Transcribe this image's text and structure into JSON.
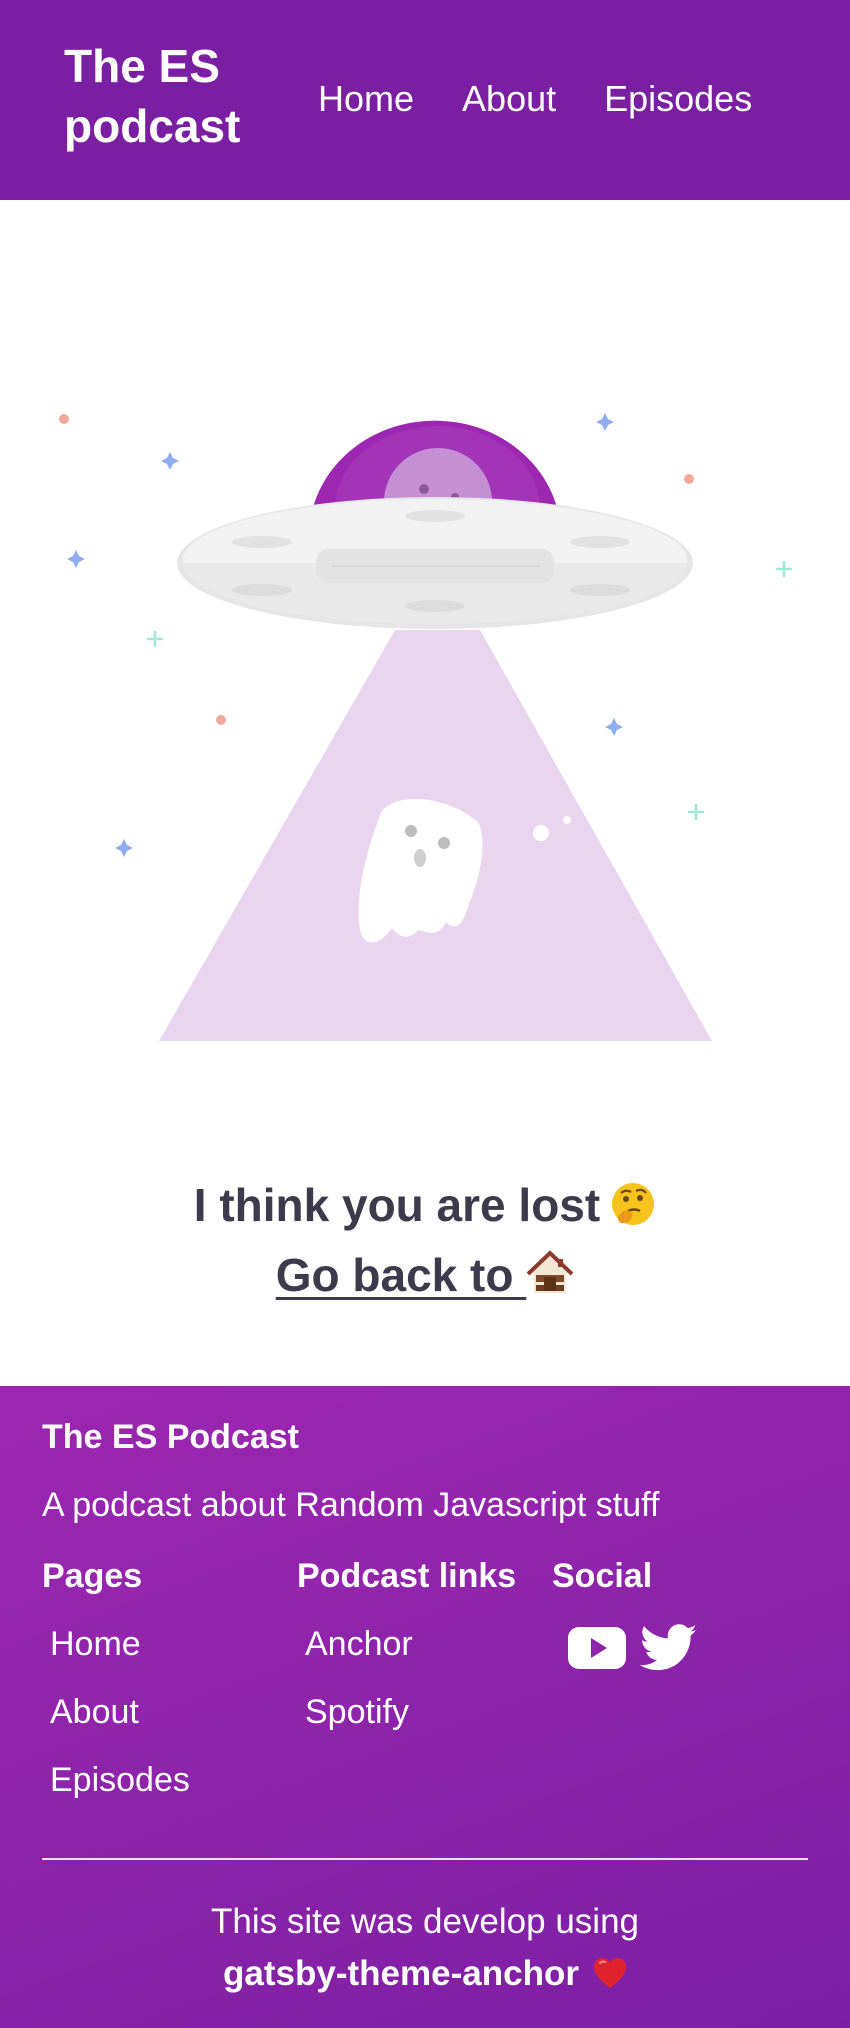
{
  "header": {
    "brand": "The ES podcast",
    "nav": [
      "Home",
      "About",
      "Episodes"
    ]
  },
  "illustration": {
    "icon": "ufo-abducting-ghost-illustration",
    "colors": {
      "saucer_dome": "#9c27b0",
      "beam": "#ead5f0"
    }
  },
  "message": {
    "lost_text": "I think you are lost",
    "lost_emoji": "thinking-face-icon",
    "back_text": "Go back to",
    "back_emoji": "house-icon"
  },
  "footer": {
    "title": "The ES Podcast",
    "description": "A podcast about Random Javascript stuff",
    "pages_heading": "Pages",
    "pages": [
      "Home",
      "About",
      "Episodes"
    ],
    "links_heading": "Podcast links",
    "links": [
      "Anchor",
      "Spotify"
    ],
    "social_heading": "Social",
    "social": [
      "youtube-icon",
      "twitter-icon"
    ],
    "credit_line1": "This site was develop using",
    "credit_brand": "gatsby-theme-anchor",
    "credit_emoji": "heart-icon"
  },
  "colors": {
    "primary": "#7b1fa2",
    "footer_gradient_top": "#9c27b0",
    "text_dark": "#3d3a4b"
  }
}
